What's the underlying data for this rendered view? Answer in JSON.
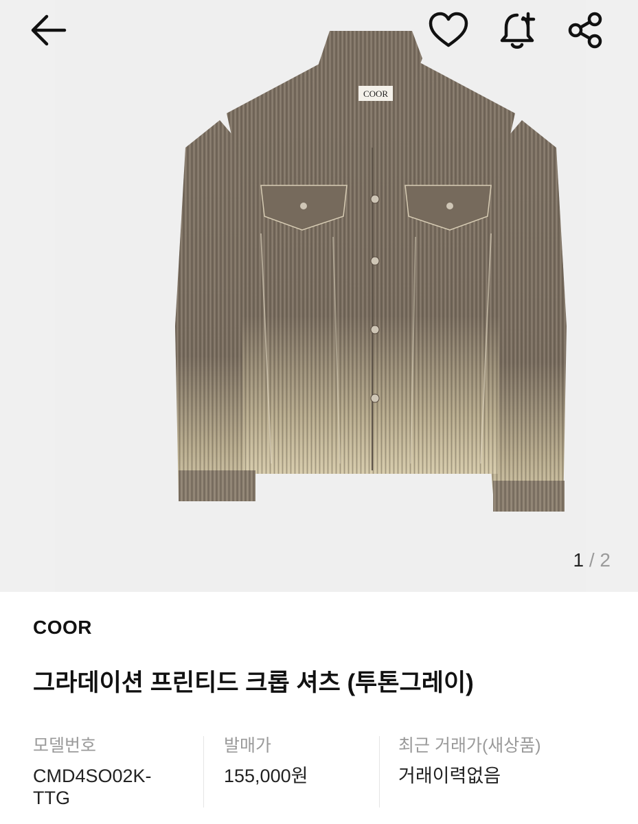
{
  "gallery": {
    "current": "1",
    "separator": "/",
    "total": "2",
    "image_alt": "Corduroy gradation cropped shirt jacket",
    "label_text": "COOR"
  },
  "header": {
    "back_icon": "arrow-left-icon",
    "like_icon": "heart-icon",
    "alert_icon": "bell-plus-icon",
    "share_icon": "share-icon"
  },
  "product": {
    "brand": "COOR",
    "title": "그라데이션 프린티드 크롭 셔츠 (투톤그레이)"
  },
  "specs": [
    {
      "label": "모델번호",
      "value": "CMD4SO02K-\nTTG"
    },
    {
      "label": "발매가",
      "value": "155,000원"
    },
    {
      "label": "최근 거래가(새상품)",
      "value": "거래이력없음"
    }
  ],
  "colors": {
    "hero_bg": "#efefef",
    "jacket": "#7d7163",
    "jacket_light": "#cbbf9f"
  }
}
